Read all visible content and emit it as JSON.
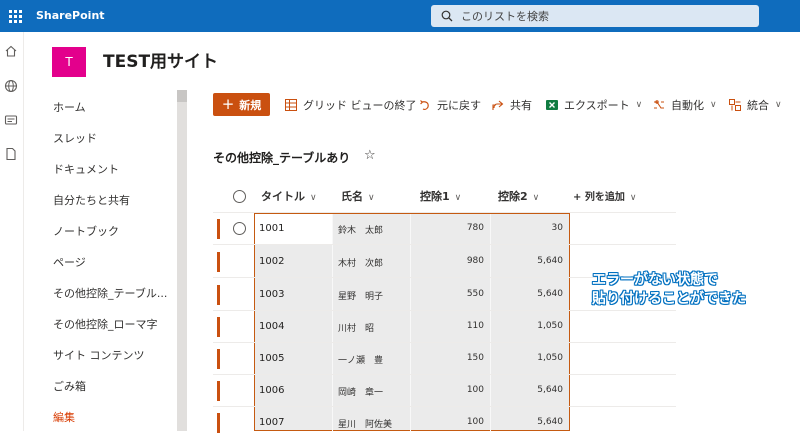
{
  "suite": {
    "brand": "SharePoint",
    "search_placeholder": "このリストを検索"
  },
  "site": {
    "logo_letter": "T",
    "title": "TEST用サイト"
  },
  "nav": {
    "items": [
      "ホーム",
      "スレッド",
      "ドキュメント",
      "自分たちと共有",
      "ノートブック",
      "ページ",
      "その他控除_テーブル...",
      "その他控除_ローマ字",
      "サイト コンテンツ",
      "ごみ箱",
      "編集"
    ]
  },
  "commands": {
    "new": "新規",
    "grid_view_exit": "グリッド ビューの終了",
    "undo": "元に戻す",
    "share": "共有",
    "export": "エクスポート",
    "automate": "自動化",
    "integrate": "統合"
  },
  "list": {
    "title": "その他控除_テーブルあり",
    "columns": [
      "タイトル",
      "氏名",
      "控除1",
      "控除2",
      "+ 列を追加"
    ],
    "rows": [
      {
        "title": "1001",
        "name": "鈴木　太郎",
        "d1": "780",
        "d2": "30"
      },
      {
        "title": "1002",
        "name": "木村　次郎",
        "d1": "980",
        "d2": "5,640"
      },
      {
        "title": "1003",
        "name": "星野　明子",
        "d1": "550",
        "d2": "5,640"
      },
      {
        "title": "1004",
        "name": "川村　昭",
        "d1": "110",
        "d2": "1,050"
      },
      {
        "title": "1005",
        "name": "一ノ瀬　豊",
        "d1": "150",
        "d2": "1,050"
      },
      {
        "title": "1006",
        "name": "岡崎　章一",
        "d1": "100",
        "d2": "5,640"
      },
      {
        "title": "1007",
        "name": "星川　阿佐美",
        "d1": "100",
        "d2": "5,640"
      }
    ]
  },
  "annotation": {
    "line1": "エラーがない状態で",
    "line2": "貼り付けることができた"
  },
  "colors": {
    "suite_bar": "#0f6cbd",
    "accent": "#ca5010",
    "site_logo": "#e3008c"
  }
}
